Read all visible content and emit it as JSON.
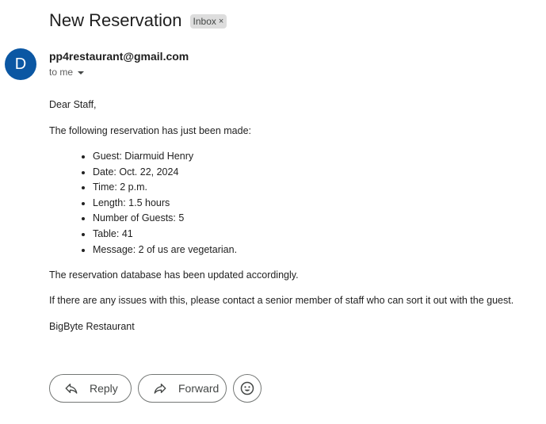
{
  "email": {
    "subject": "New Reservation",
    "label": "Inbox",
    "label_close": "×",
    "avatar_letter": "D",
    "sender": "pp4restaurant@gmail.com",
    "recipients": "to me"
  },
  "body": {
    "greeting": "Dear Staff,",
    "intro": "The following reservation has just been made:",
    "details": [
      "Guest: Diarmuid Henry",
      "Date: Oct. 22, 2024",
      "Time: 2 p.m.",
      "Length: 1.5 hours",
      "Number of Guests: 5",
      "Table: 41",
      "Message: 2 of us are vegetarian."
    ],
    "updated": "The reservation database has been updated accordingly.",
    "issues": "If there are any issues with this, please contact a senior member of staff who can sort it out with the guest.",
    "signoff": "BigByte Restaurant"
  },
  "actions": {
    "reply_label": "Reply",
    "forward_label": "Forward",
    "reply_icon": "reply-icon",
    "forward_icon": "forward-icon",
    "emoji_icon": "emoji-icon"
  },
  "colors": {
    "avatar": "#0b57a3",
    "label_chip": "#dddddd"
  }
}
